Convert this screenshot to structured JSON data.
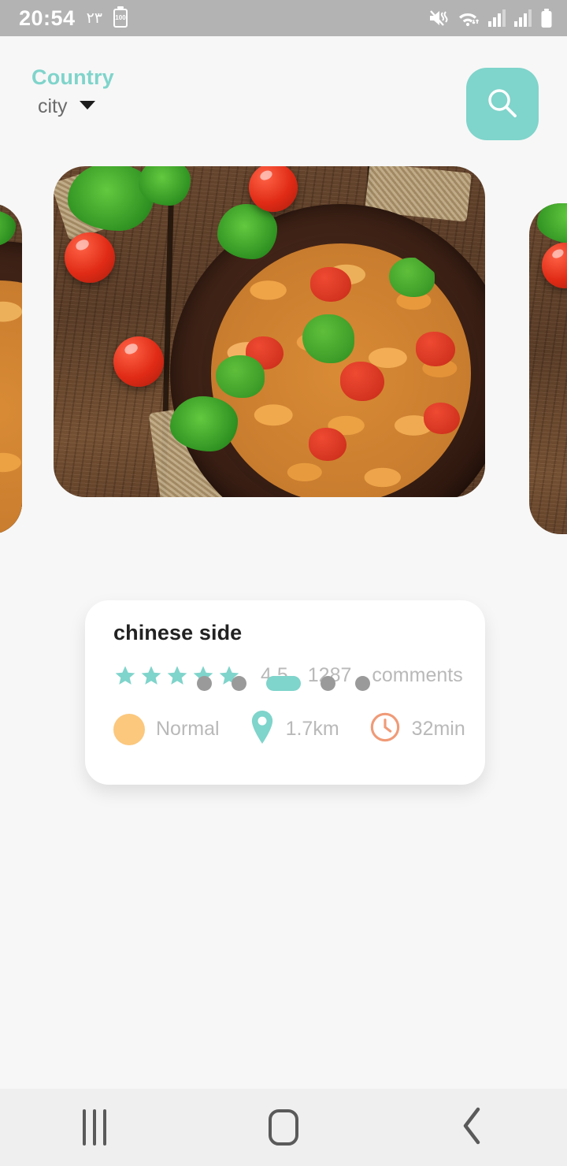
{
  "status_bar": {
    "time": "20:54",
    "arabic_badge": "٢٣",
    "battery_label": "100",
    "icons": [
      "mute-vibrate-icon",
      "wifi-icon",
      "signal-bars-icon",
      "signal-bars-2-icon",
      "battery-icon"
    ],
    "background_color": "#b3b3b3"
  },
  "header": {
    "country_label": "Country",
    "city_label": "city",
    "caret_icon": "chevron-down-icon",
    "search_icon": "search-icon",
    "accent_color": "#7fd4cb"
  },
  "card": {
    "title": "chinese side",
    "stars_filled": 5,
    "rating": "4.5",
    "review_count": "1287",
    "review_word": "comments",
    "meta": [
      {
        "icon": "price-level-dot-icon",
        "label": "Normal",
        "color": "#fbc87e"
      },
      {
        "icon": "location-pin-icon",
        "label": "1.7km",
        "color": "#7fd4cb"
      },
      {
        "icon": "clock-icon",
        "label": "32min",
        "color": "#f09b78"
      }
    ],
    "image_alt": "penne-pasta-bowl-photo"
  },
  "pager": {
    "total": 5,
    "active_index": 2,
    "active_color": "#7fd4cb",
    "inactive_color": "#9a9a9a"
  },
  "nav_bar": {
    "recents_icon": "recents-icon",
    "home_icon": "home-icon",
    "back_icon": "back-chevron-icon"
  },
  "theme": {
    "page_background": "#f7f7f7",
    "accent": "#7fd4cb",
    "muted_text": "#b9b9b9",
    "title_text": "#222222"
  }
}
